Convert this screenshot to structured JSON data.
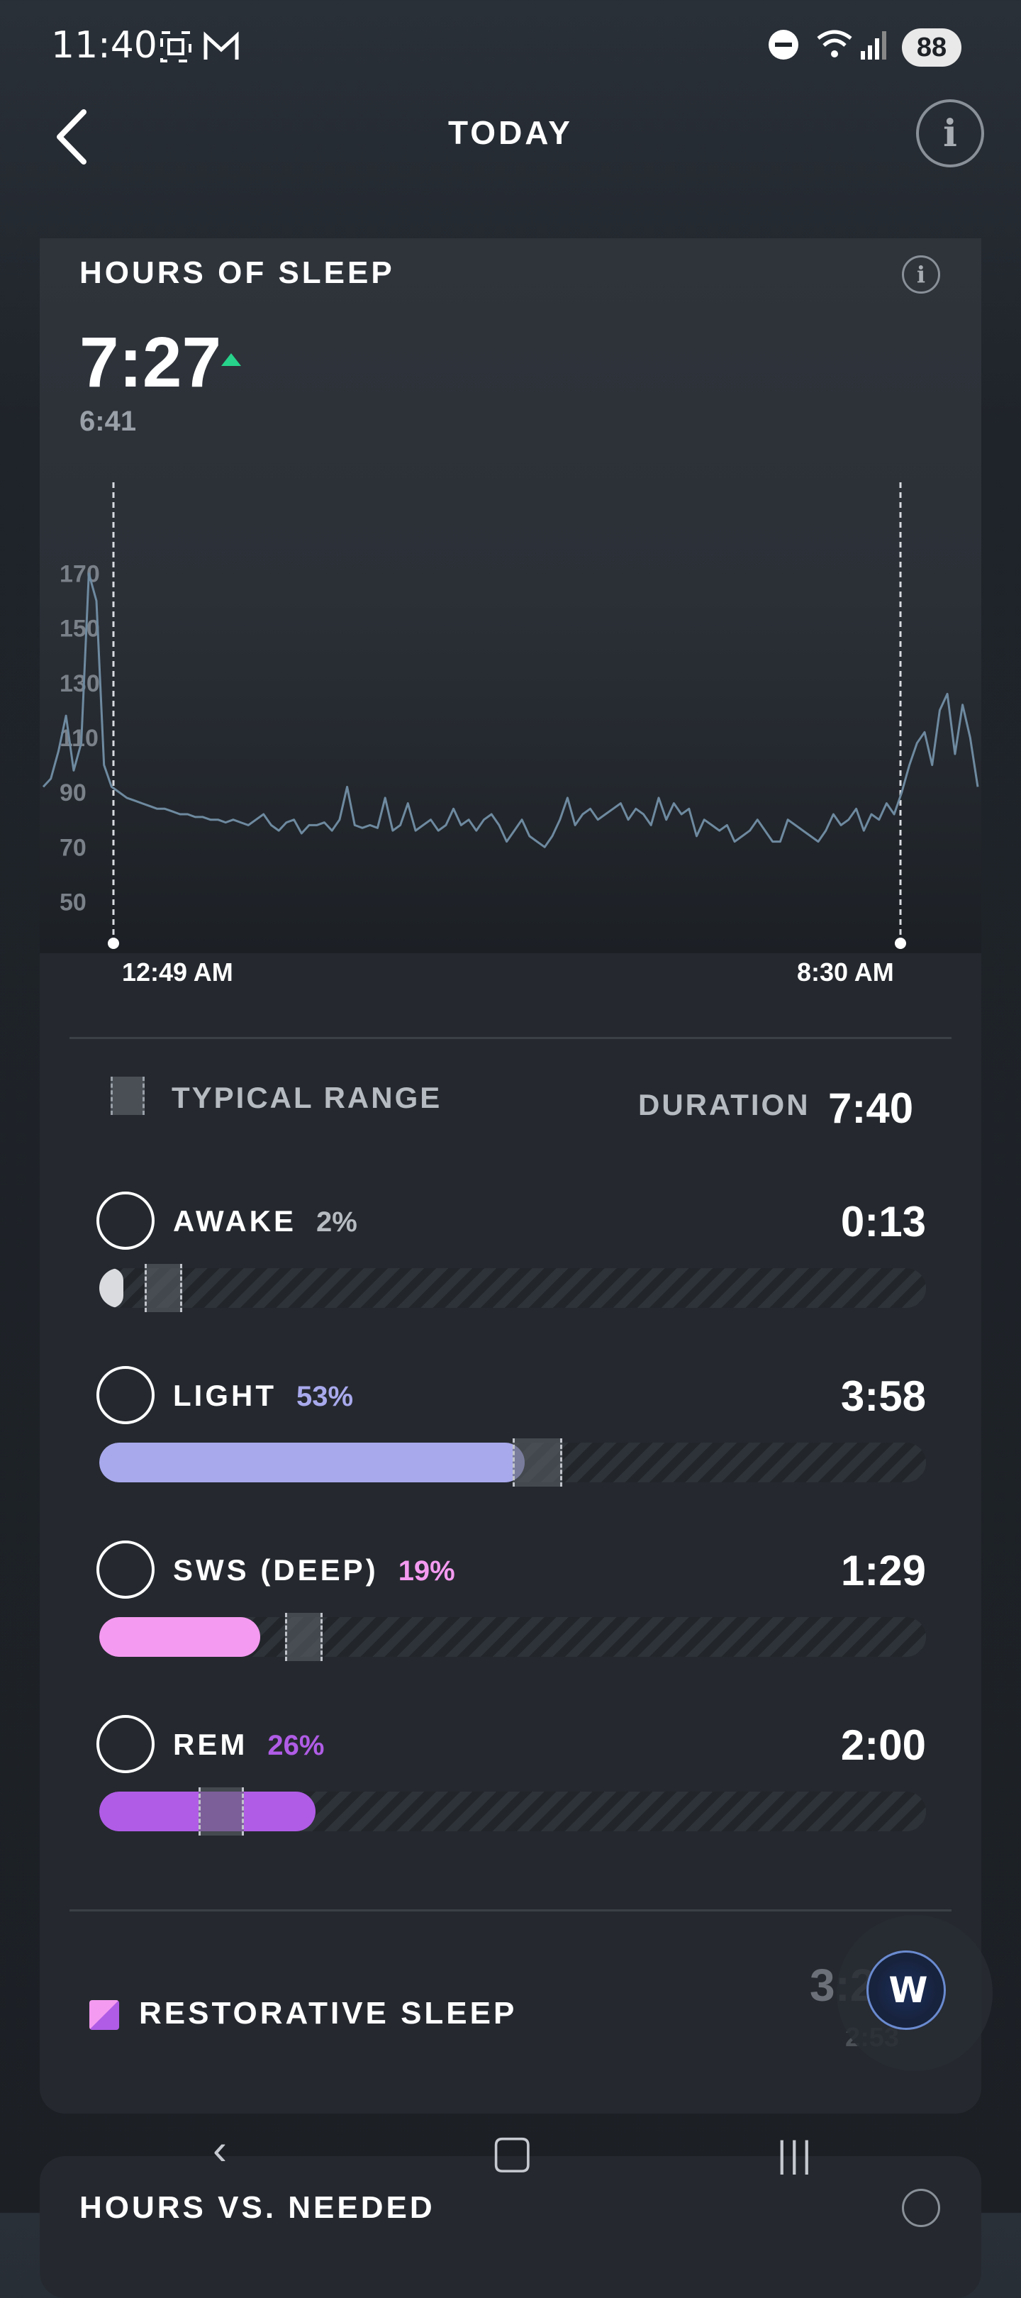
{
  "status_bar": {
    "time": "11:40",
    "battery": "88",
    "icons": [
      "screenshot-icon",
      "gmail-icon",
      "dnd-icon",
      "wifi-icon",
      "signal-icon"
    ]
  },
  "header": {
    "title": "TODAY",
    "back_icon": "chevron-left-icon",
    "info_icon": "info-icon"
  },
  "hours_of_sleep": {
    "title": "HOURS OF SLEEP",
    "value": "7:27",
    "previous": "6:41",
    "trend": "up",
    "trend_color": "#27d38a"
  },
  "chart_data": {
    "type": "line",
    "yticks": [
      "170",
      "150",
      "130",
      "110",
      "90",
      "70",
      "50"
    ],
    "ylim": [
      40,
      180
    ],
    "start_label": "12:49 AM",
    "end_label": "8:30 AM",
    "series": [
      {
        "color": "#6e8aa0",
        "values": [
          92,
          95,
          105,
          118,
          98,
          108,
          170,
          160,
          100,
          92,
          90,
          88,
          87,
          86,
          85,
          84,
          84,
          83,
          82,
          82,
          81,
          81,
          80,
          80,
          79,
          80,
          79,
          78,
          80,
          82,
          78,
          76,
          79,
          80,
          75,
          78,
          78,
          79,
          76,
          80,
          92,
          78,
          77,
          78,
          77,
          88,
          76,
          78,
          86,
          76,
          78,
          80,
          76,
          78,
          84,
          78,
          80,
          76,
          80,
          82,
          78,
          72,
          76,
          80,
          74,
          72,
          70,
          74,
          80,
          88,
          78,
          82,
          84,
          80,
          82,
          84,
          86,
          80,
          84,
          82,
          78,
          88,
          80,
          86,
          82,
          84,
          74,
          80,
          78,
          76,
          78,
          72,
          74,
          76,
          80,
          76,
          72,
          72,
          80,
          78,
          76,
          74,
          72,
          76,
          82,
          78,
          80,
          84,
          76,
          82,
          80,
          86,
          82,
          90,
          100,
          108,
          112,
          100,
          120,
          126,
          104,
          122,
          110,
          92
        ]
      }
    ]
  },
  "legend": {
    "typical_range": "TYPICAL RANGE",
    "duration_label": "DURATION",
    "duration_value": "7:40"
  },
  "stages": [
    {
      "name": "AWAKE",
      "pct": "2%",
      "duration": "0:13",
      "color": "#d9dbdf",
      "pct_color": "#b6bbc2",
      "fill": 0.025,
      "range": [
        0.055,
        0.1
      ]
    },
    {
      "name": "LIGHT",
      "pct": "53%",
      "duration": "3:58",
      "color": "#a8a9ec",
      "pct_color": "#a8a9ec",
      "fill": 0.515,
      "range": [
        0.5,
        0.56
      ]
    },
    {
      "name": "SWS (DEEP)",
      "pct": "19%",
      "duration": "1:29",
      "color": "#f49af0",
      "pct_color": "#f49af0",
      "fill": 0.195,
      "range": [
        0.225,
        0.27
      ]
    },
    {
      "name": "REM",
      "pct": "26%",
      "duration": "2:00",
      "color": "#b05ce6",
      "pct_color": "#b05ce6",
      "fill": 0.262,
      "range": [
        0.12,
        0.175
      ]
    }
  ],
  "restorative": {
    "label": "RESTORATIVE SLEEP",
    "value": "3:29",
    "sub": "2:53"
  },
  "next_card": {
    "title": "HOURS VS. NEEDED"
  },
  "nav": {
    "back": "‹",
    "home": "▢",
    "recents": "|||"
  }
}
